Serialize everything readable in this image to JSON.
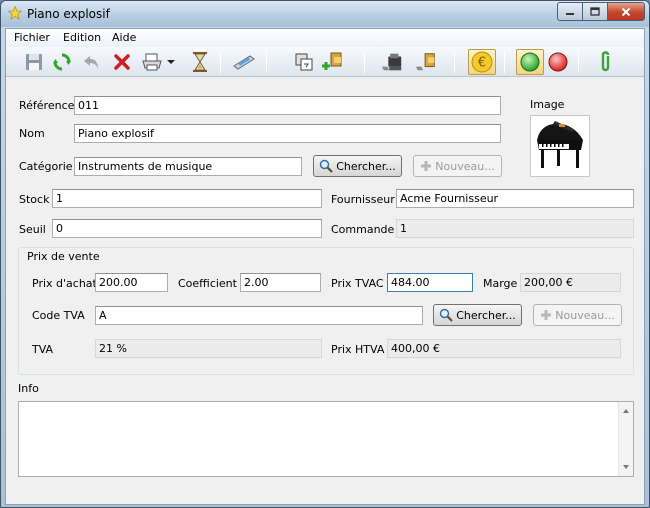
{
  "window": {
    "title": "Piano explosif"
  },
  "menu": {
    "items": [
      "Fichier",
      "Edition",
      "Aide"
    ]
  },
  "toolbar": {
    "buttons": [
      "save-icon",
      "refresh-icon",
      "undo-icon",
      "delete-icon",
      "print-icon",
      "dropdown-arrow-icon",
      "hourglass-icon",
      "scanner-icon",
      "copy-icon",
      "add-product-icon",
      "register-icon",
      "stock-icon",
      "euro-icon",
      "green-light-icon",
      "red-light-icon",
      "paperclip-icon"
    ]
  },
  "form": {
    "reference": {
      "label": "Référence",
      "value": "011"
    },
    "nom": {
      "label": "Nom",
      "value": "Piano explosif"
    },
    "categorie": {
      "label": "Catégorie",
      "value": "Instruments de musique",
      "search_label": "Chercher...",
      "new_label": "Nouveau..."
    },
    "image": {
      "label": "Image"
    },
    "stock": {
      "label": "Stock",
      "value": "1"
    },
    "seuil": {
      "label": "Seuil",
      "value": "0"
    },
    "fournisseur": {
      "label": "Fournisseur",
      "value": "Acme Fournisseur"
    },
    "commande": {
      "label": "Commande",
      "value": "1"
    }
  },
  "prix_de_vente": {
    "title": "Prix de vente",
    "prix_achat": {
      "label": "Prix d'achat",
      "value": "200.00"
    },
    "coefficient": {
      "label": "Coefficient",
      "value": "2.00"
    },
    "prix_tvac": {
      "label": "Prix TVAC",
      "value": "484.00"
    },
    "marge": {
      "label": "Marge",
      "value": "200,00 €"
    },
    "code_tva": {
      "label": "Code TVA",
      "value": "A",
      "search_label": "Chercher...",
      "new_label": "Nouveau..."
    },
    "tva": {
      "label": "TVA",
      "value": "21 %"
    },
    "prix_htva": {
      "label": "Prix HTVA",
      "value": "400,00 €"
    }
  },
  "info": {
    "label": "Info",
    "value": ""
  },
  "colors": {
    "accent": "#3c7fb1",
    "selected_tool": "#f3d57d"
  }
}
